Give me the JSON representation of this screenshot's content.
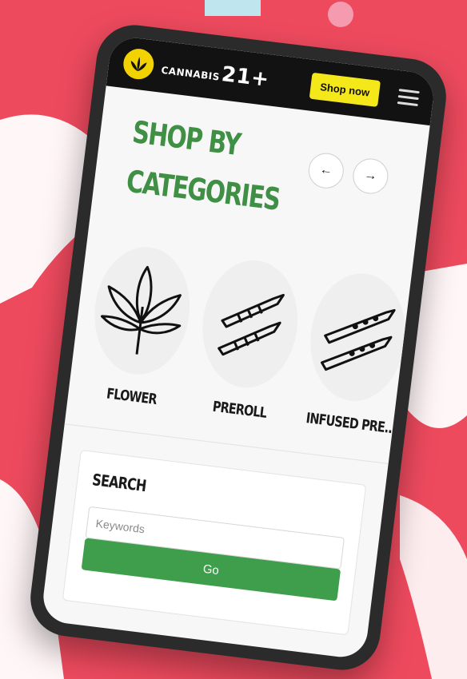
{
  "brand": {
    "name": "CANNABIS",
    "age": "21+"
  },
  "header": {
    "shop_label": "Shop now"
  },
  "section": {
    "title_line1": "SHOP BY",
    "title_line2": "CATEGORIES"
  },
  "nav": {
    "prev_symbol": "←",
    "next_symbol": "→"
  },
  "categories": [
    {
      "label": "FLOWER",
      "icon": "cannabis-leaf-icon"
    },
    {
      "label": "PREROLL",
      "icon": "preroll-icon"
    },
    {
      "label": "INFUSED PRE...",
      "icon": "infused-preroll-icon"
    }
  ],
  "search": {
    "title": "SEARCH",
    "placeholder": "Keywords",
    "value": "",
    "button_label": "Go"
  },
  "colors": {
    "background": "#ee4a5e",
    "accent_green": "#3f8f45",
    "shop_button": "#f4e81b",
    "header_bg": "#121212"
  }
}
